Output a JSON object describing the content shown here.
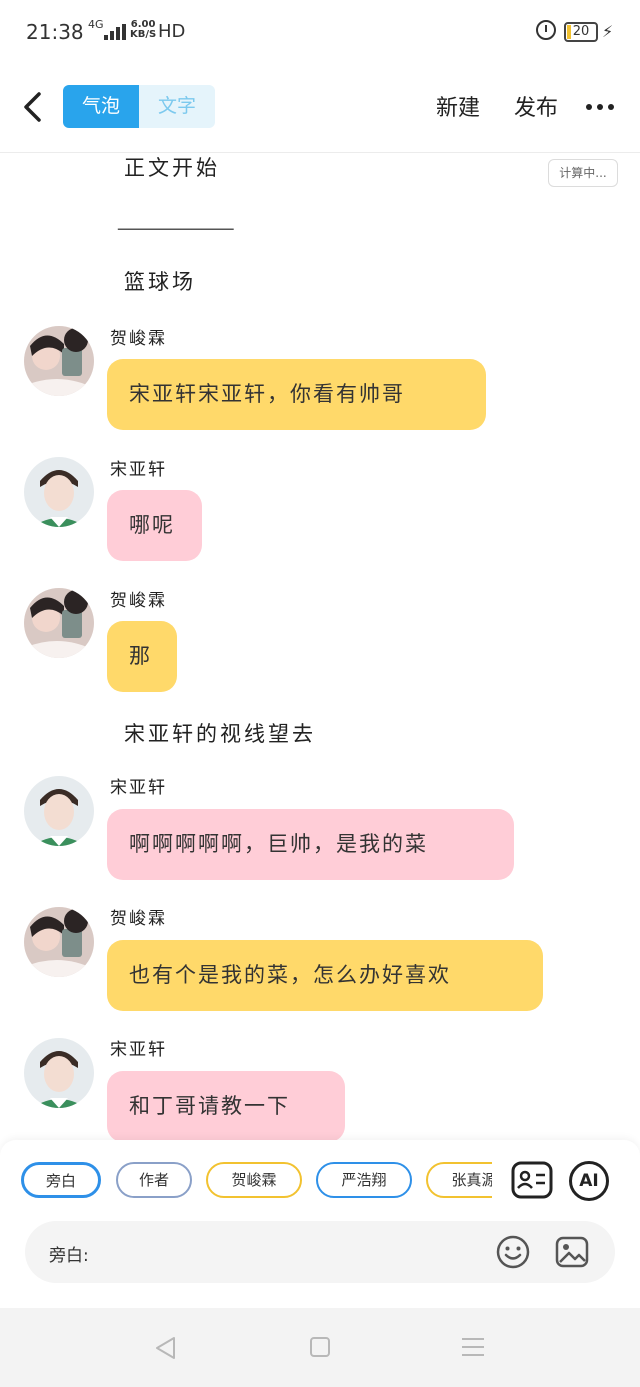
{
  "status_bar": {
    "time": "21:38",
    "network": "4G",
    "speed_value": "6.00",
    "speed_unit": "KB/S",
    "hd": "HD",
    "battery": "20"
  },
  "header": {
    "tabs": [
      {
        "label": "气泡",
        "active": true
      },
      {
        "label": "文字",
        "active": false
      }
    ],
    "new_label": "新建",
    "publish_label": "发布"
  },
  "chat": {
    "timer_label": "计算中...",
    "narrations": [
      "正文开始",
      "___________",
      "篮球场",
      "宋亚轩的视线望去"
    ],
    "messages": [
      {
        "speaker": "贺峻霖",
        "text": "宋亚轩宋亚轩，你看有帅哥",
        "color": "#ffd96a"
      },
      {
        "speaker": "宋亚轩",
        "text": "哪呢",
        "color": "#ffcdd7"
      },
      {
        "speaker": "贺峻霖",
        "text": "那",
        "color": "#ffd96a"
      },
      {
        "speaker": "宋亚轩",
        "text": "啊啊啊啊啊，巨帅，是我的菜",
        "color": "#ffcdd7"
      },
      {
        "speaker": "贺峻霖",
        "text": "也有个是我的菜，怎么办好喜欢",
        "color": "#ffd96a"
      },
      {
        "speaker": "宋亚轩",
        "text": "和丁哥请教一下",
        "color": "#ffcdd7"
      }
    ]
  },
  "composer": {
    "role_chips": [
      {
        "label": "旁白",
        "active": true
      },
      {
        "label": "作者",
        "active": false
      },
      {
        "label": "贺峻霖",
        "active": false
      },
      {
        "label": "严浩翔",
        "active": false
      },
      {
        "label": "张真源",
        "active": false
      }
    ],
    "ai_label": "AI",
    "input_prefix": "旁白:",
    "input_value": ""
  },
  "colors": {
    "accent_blue": "#29a4ec",
    "bubble_yellow": "#ffd96a",
    "bubble_pink": "#ffcdd7"
  }
}
